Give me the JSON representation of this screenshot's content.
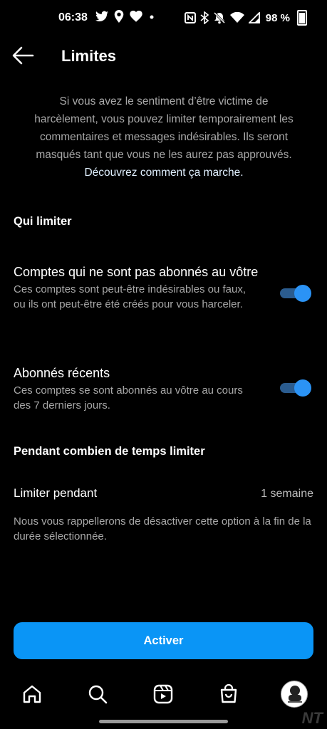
{
  "status_bar": {
    "time": "06:38",
    "left_icons": [
      "twitter-icon",
      "location-icon",
      "heart-icon",
      "dot-icon"
    ],
    "right_icons": [
      "nfc-icon",
      "bluetooth-icon",
      "mute-icon",
      "wifi-icon",
      "signal-icon"
    ],
    "battery": "98 %"
  },
  "header": {
    "title": "Limites",
    "back_icon": "arrow-left-icon"
  },
  "intro": {
    "text": "Si vous avez le sentiment d’être victime de harcèlement, vous pouvez limiter temporairement les commentaires et messages indésirables. Ils seront masqués tant que vous ne les aurez pas approuvés.",
    "link": "Découvrez comment ça marche."
  },
  "sections": {
    "who": {
      "title": "Qui limiter",
      "options": [
        {
          "title": "Comptes qui ne sont pas abonnés au vôtre",
          "description": "Ces comptes sont peut-être indésirables ou faux, ou ils ont peut-être été créés pour vous harceler.",
          "enabled": true
        },
        {
          "title": "Abonnés récents",
          "description": "Ces comptes se sont abonnés au vôtre au cours des 7 derniers jours.",
          "enabled": true
        }
      ]
    },
    "duration": {
      "title": "Pendant combien de temps limiter",
      "label": "Limiter pendant",
      "value": "1 semaine",
      "note": "Nous vous rappellerons de désactiver cette option à la fin de la durée sélectionnée."
    }
  },
  "action": {
    "label": "Activer"
  },
  "bottom_nav": {
    "items": [
      "home-icon",
      "search-icon",
      "reels-icon",
      "shop-icon",
      "profile-avatar"
    ]
  },
  "watermark": "NT",
  "colors": {
    "background": "#000000",
    "accent": "#0a95f6",
    "toggle_knob": "#2b93f5",
    "toggle_track": "#2b5c8f",
    "secondary_text": "#a8a8a8"
  }
}
